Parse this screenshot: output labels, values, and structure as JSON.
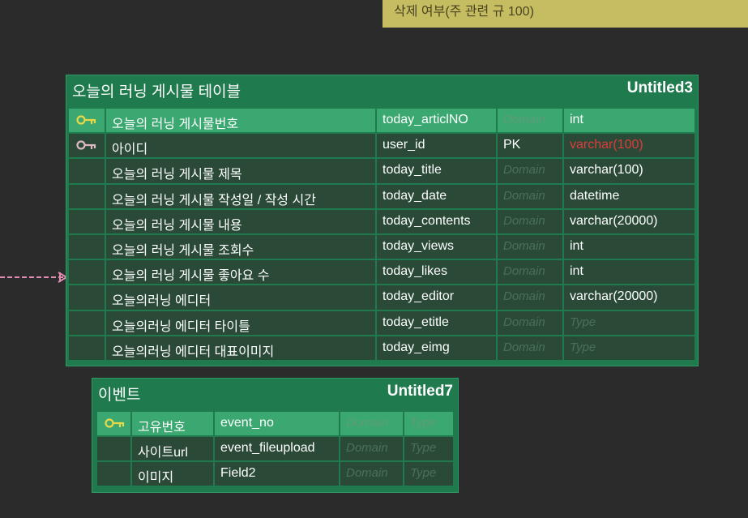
{
  "note": {
    "text": "삭제 여부(주 관련 규 100)"
  },
  "colors": {
    "entity_bg": "#1f7a4d",
    "pk_row": "#3aa870",
    "row": "#2a4a37",
    "key_gold": "#e8d84a",
    "key_pink": "#e0b8c0",
    "note_bg": "#c6bc61",
    "error_text": "#e23a3a",
    "relation_line": "#e08bb0"
  },
  "entity_today": {
    "name": "오늘의 러닝 게시물 테이블",
    "schema": "Untitled3",
    "rows": [
      {
        "key": "primary-key-icon",
        "logical": "오늘의 러닝 게시물번호",
        "physical": "today_articlNO",
        "domain": "Domain",
        "type": "int"
      },
      {
        "key": "foreign-key-icon",
        "logical": "아이디",
        "physical": "user_id",
        "domain": "PK",
        "type": "varchar(100)"
      },
      {
        "key": "",
        "logical": "오늘의 러닝 게시물 제목",
        "physical": "today_title",
        "domain": "Domain",
        "type": "varchar(100)"
      },
      {
        "key": "",
        "logical": "오늘의 러닝 게시물 작성일 / 작성 시간",
        "physical": "today_date",
        "domain": "Domain",
        "type": "datetime"
      },
      {
        "key": "",
        "logical": "오늘의 러닝 게시물 내용",
        "physical": "today_contents",
        "domain": "Domain",
        "type": "varchar(20000)"
      },
      {
        "key": "",
        "logical": "오늘의 러닝 게시물 조회수",
        "physical": "today_views",
        "domain": "Domain",
        "type": "int"
      },
      {
        "key": "",
        "logical": "오늘의 러닝 게시물 좋아요 수",
        "physical": "today_likes",
        "domain": "Domain",
        "type": "int"
      },
      {
        "key": "",
        "logical": "오늘의러닝 에디터",
        "physical": "today_editor",
        "domain": "Domain",
        "type": "varchar(20000)"
      },
      {
        "key": "",
        "logical": "오늘의러닝 에디터 타이틀",
        "physical": "today_etitle",
        "domain": "Domain",
        "type": "Type"
      },
      {
        "key": "",
        "logical": "오늘의러닝 에디터 대표이미지",
        "physical": "today_eimg",
        "domain": "Domain",
        "type": "Type"
      }
    ]
  },
  "entity_event": {
    "name": "이벤트",
    "schema": "Untitled7",
    "rows": [
      {
        "key": "primary-key-icon",
        "logical": "고유번호",
        "physical": "event_no",
        "domain": "Domain",
        "type": "Type"
      },
      {
        "key": "",
        "logical": "사이트url",
        "physical": "event_fileupload",
        "domain": "Domain",
        "type": "Type"
      },
      {
        "key": "",
        "logical": "이미지",
        "physical": "Field2",
        "domain": "Domain",
        "type": "Type"
      }
    ]
  }
}
